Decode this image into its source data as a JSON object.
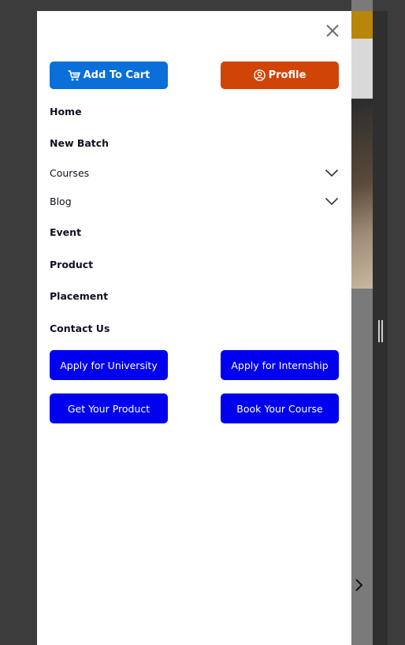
{
  "drawer": {
    "add_to_cart_label": "Add To Cart",
    "profile_label": "Profile",
    "nav_items": [
      {
        "label": "Home"
      },
      {
        "label": "New Batch"
      },
      {
        "label": "Courses"
      },
      {
        "label": "Blog"
      },
      {
        "label": "Event"
      },
      {
        "label": "Product"
      },
      {
        "label": "Placement"
      },
      {
        "label": "Contact Us"
      }
    ],
    "cta": {
      "apply_university": "Apply for University",
      "apply_internship": "Apply for Internship",
      "get_product": "Get Your Product",
      "book_course": "Book Your Course"
    }
  },
  "icons": {
    "close": "close-icon",
    "cart": "cart-icon",
    "profile": "user-circle-icon",
    "chevron": "chevron-down-icon",
    "carousel_next": "chevron-right-icon"
  },
  "colors": {
    "cart_button": "#0a6fd8",
    "profile_button": "#d04408",
    "cta_button": "#0000ee",
    "nav_text": "#111122"
  }
}
